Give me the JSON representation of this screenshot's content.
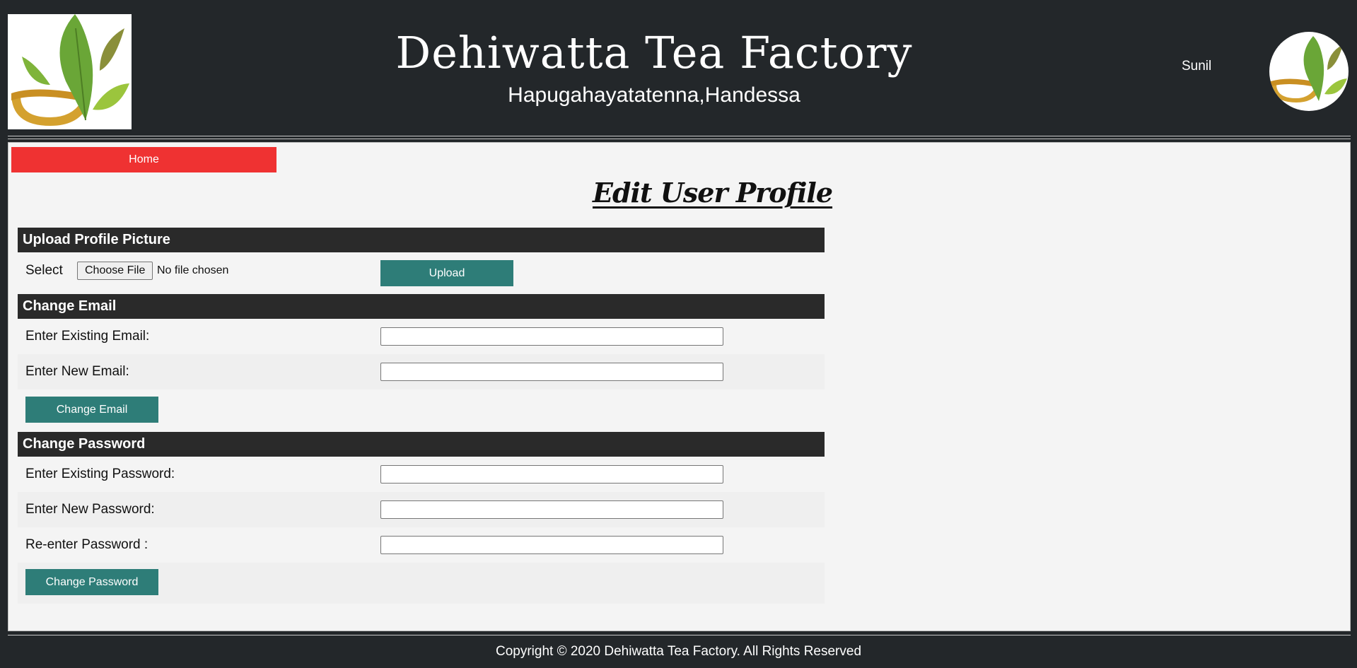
{
  "header": {
    "title": "Dehiwatta Tea Factory",
    "subtitle": "Hapugahayatatenna,Handessa",
    "username": "Sunil",
    "logo_icon": "tea-cup-leaves-icon"
  },
  "nav": {
    "home_label": "Home"
  },
  "page": {
    "title": "Edit User Profile"
  },
  "upload_section": {
    "heading": "Upload Profile Picture",
    "select_label": "Select",
    "choose_file_label": "Choose File",
    "file_status": "No file chosen",
    "upload_label": "Upload"
  },
  "email_section": {
    "heading": "Change Email",
    "existing_label": "Enter Existing Email:",
    "existing_value": "",
    "new_label": "Enter New Email:",
    "new_value": "",
    "submit_label": "Change Email"
  },
  "password_section": {
    "heading": "Change Password",
    "existing_label": "Enter Existing Password:",
    "new_label": "Enter New Password:",
    "reenter_label": "Re-enter Password :",
    "submit_label": "Change Password"
  },
  "footer": {
    "copyright": "Copyright © 2020 Dehiwatta Tea Factory. All Rights Reserved"
  },
  "colors": {
    "header_bg": "#23272a",
    "home_button": "#ef3232",
    "action_button": "#2e7d78",
    "section_header": "#2a2a2a"
  }
}
